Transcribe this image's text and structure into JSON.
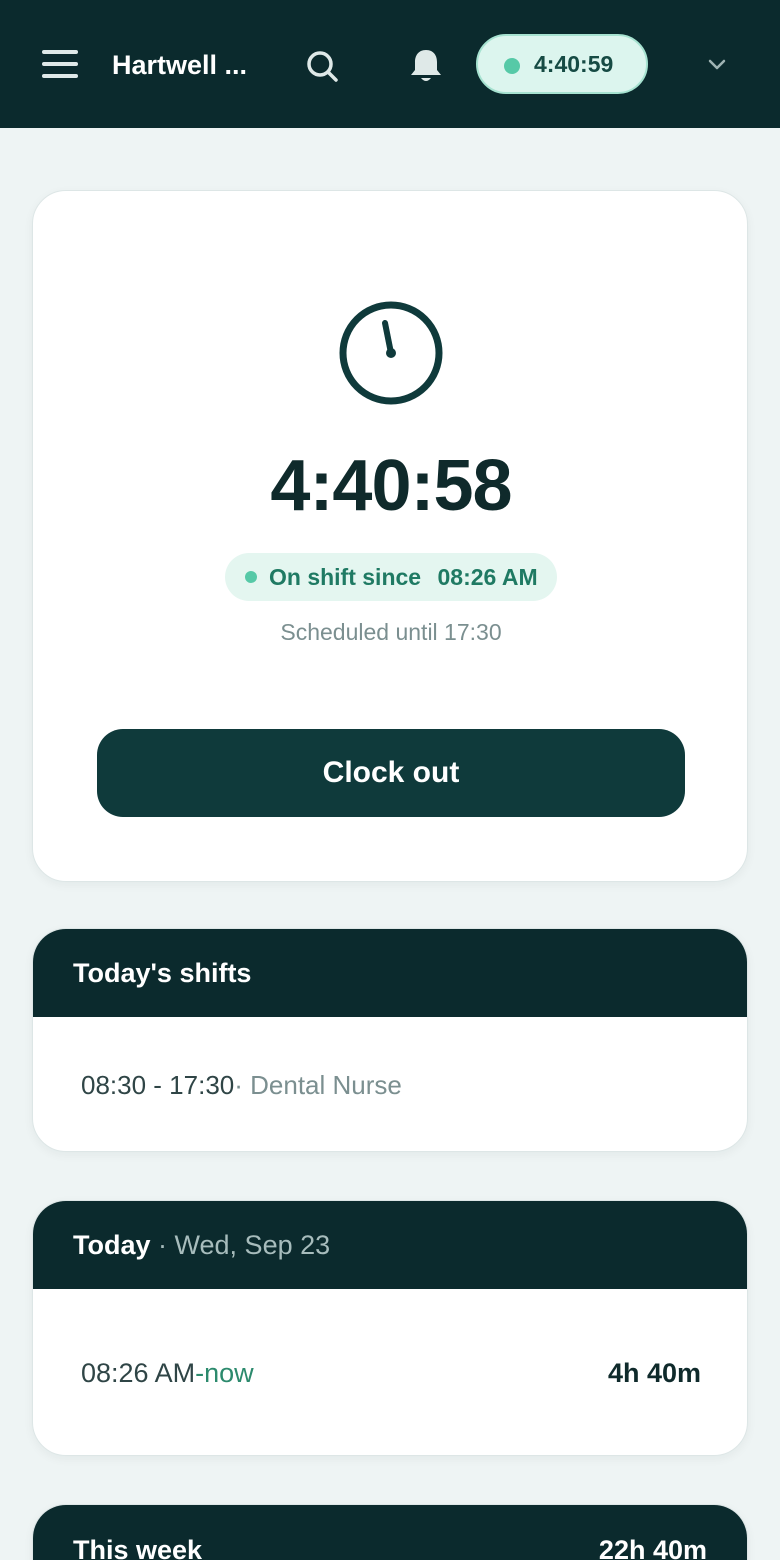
{
  "header": {
    "app_title": "Hartwell ...",
    "timer": "4:40:59"
  },
  "clock": {
    "elapsed": "4:40:58",
    "status_label": "On shift since",
    "since_time": "08:26 AM",
    "scheduled": "Scheduled until 17:30",
    "clock_out_label": "Clock out"
  },
  "shifts": {
    "title": "Today's shifts",
    "items": [
      {
        "time": "08:30 - 17:30",
        "role": "· Dental Nurse"
      }
    ]
  },
  "today": {
    "title": "Today",
    "date": "· Wed, Sep 23",
    "entries": [
      {
        "start": "08:26 AM",
        "end": "-now",
        "duration": "4h 40m"
      }
    ]
  },
  "week": {
    "title": "This week",
    "total": "22h 40m"
  },
  "colors": {
    "header_bg": "#0b2a2d",
    "accent": "#56c9a7",
    "button_bg": "#0f3a3b"
  }
}
